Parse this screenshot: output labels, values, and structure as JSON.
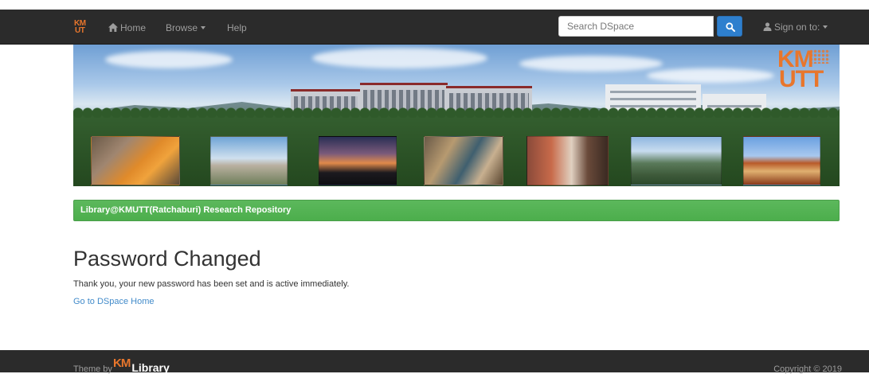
{
  "navbar": {
    "brand_line1": "KM",
    "brand_line2": "UT",
    "home_label": "Home",
    "browse_label": "Browse",
    "help_label": "Help",
    "search_placeholder": "Search DSpace",
    "signon_label": "Sign on to:"
  },
  "banner": {
    "logo_line1": "KM",
    "logo_line2": "UTT"
  },
  "repository": {
    "title": "Library@KMUTT(Ratchaburi) Research Repository"
  },
  "main": {
    "page_title": "Password Changed",
    "message": "Thank you, your new password has been set and is active immediately.",
    "home_link": "Go to DSpace Home"
  },
  "footer": {
    "theme_by": "Theme by",
    "logo_km": "KM",
    "logo_library": "Library",
    "copyright": "Copyright © 2019"
  },
  "colors": {
    "navbar_bg": "#2b2b2b",
    "accent_orange": "#e8762c",
    "search_button": "#2e7fce",
    "green_bar": "#5cb85c",
    "link": "#428bca"
  }
}
